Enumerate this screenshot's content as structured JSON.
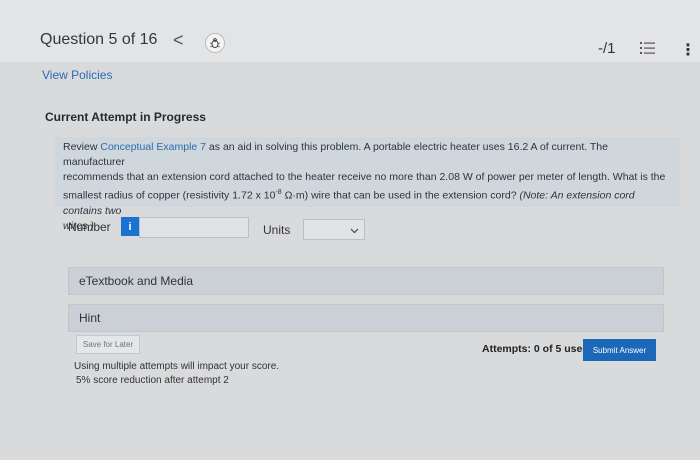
{
  "header": {
    "question_counter": "Question 5 of 16",
    "back_glyph": "<",
    "score": "-/1",
    "menu_glyph": "⋮"
  },
  "policies_link": "View Policies",
  "attempt_title": "Current Attempt in Progress",
  "question": {
    "intro_prefix": "Review ",
    "link_text": "Conceptual Example 7",
    "line1_rest": " as an aid in solving this problem. A portable electric heater uses 16.2 A of current. The manufacturer",
    "line2": "recommends that an extension cord attached to the heater receive no more than 2.08 W of power per meter of length. What is the",
    "line3_a": "smallest radius of copper (resistivity 1.72 x 10",
    "exponent": "-8",
    "line3_b": " Ω·m) wire that can be used in the extension cord? ",
    "note": "(Note: An extension cord contains two",
    "line4_note": "wires.)"
  },
  "answer": {
    "number_label": "Number",
    "info_glyph": "i",
    "number_value": "",
    "units_label": "Units",
    "units_selected": ""
  },
  "panels": {
    "etextbook": "eTextbook and Media",
    "hint": "Hint"
  },
  "footer": {
    "save_label": "Save for Later",
    "attempts": "Attempts: 0 of 5 used",
    "submit_label": "Submit Answer",
    "warning_line1": "Using multiple attempts will impact your score.",
    "warning_line2": "5% score reduction after attempt 2"
  },
  "colors": {
    "accent": "#1b68b8",
    "link": "#2b6bb0"
  },
  "icons": [
    "back-chevron-icon",
    "bug-report-icon",
    "list-icon",
    "more-options-icon",
    "info-icon",
    "chevron-down-icon"
  ]
}
